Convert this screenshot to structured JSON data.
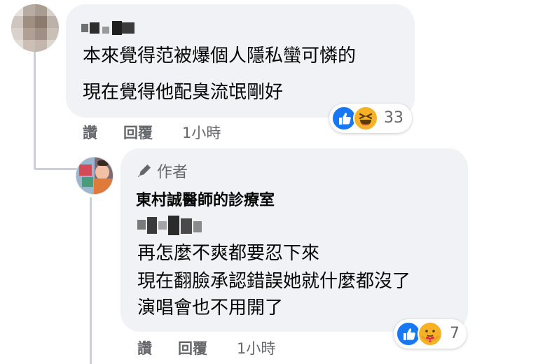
{
  "comment": {
    "author_name_blurred": "",
    "lines": [
      "本來覺得范被爆個人隱私蠻可憐的",
      "現在覺得他配臭流氓剛好"
    ],
    "actions": {
      "like": "讚",
      "reply": "回覆",
      "time": "1小時"
    },
    "reactions": {
      "icons": [
        "like-icon",
        "laugh-icon"
      ],
      "count": "33"
    }
  },
  "reply": {
    "author_badge": "作者",
    "page_name": "東村誠醫師的診療室",
    "lines": [
      "再怎麼不爽都要忍下來",
      "現在翻臉承認錯誤她就什麼都沒了",
      "演唱會也不用開了"
    ],
    "actions": {
      "like": "讚",
      "reply": "回覆",
      "time": "1小時"
    },
    "reactions": {
      "icons": [
        "like-icon",
        "care-icon"
      ],
      "count": "7"
    }
  },
  "colors": {
    "bubble": "#f0f2f5",
    "secondary_text": "#65676b",
    "like_blue": "#1877f2",
    "haha_yellow": "#f7b125"
  }
}
